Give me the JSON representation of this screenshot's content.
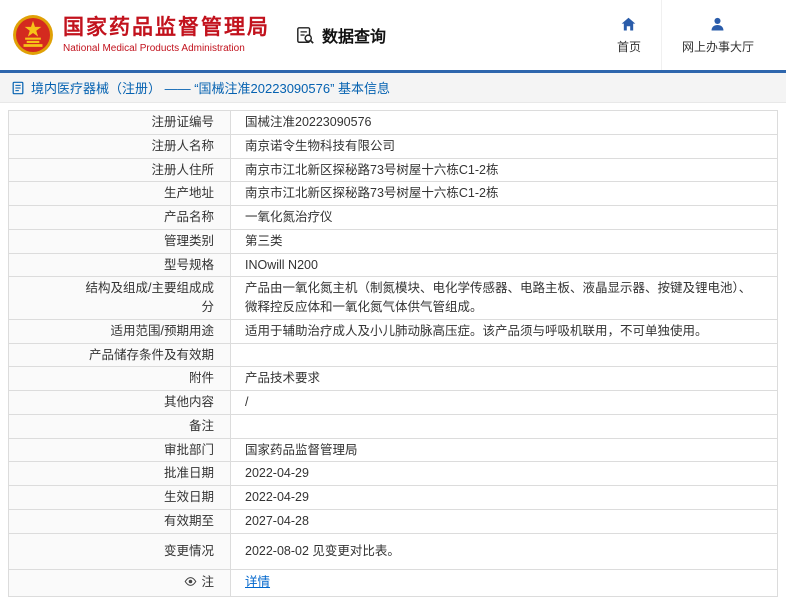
{
  "header": {
    "org_name_cn": "国家药品监督管理局",
    "org_name_en": "National Medical Products Administration",
    "data_query_label": "数据查询",
    "nav_home_label": "首页",
    "nav_hall_label": "网上办事大厅"
  },
  "breadcrumb": {
    "text": "境内医疗器械（注册） —— “国械注准20223090576” 基本信息"
  },
  "colors": {
    "brand_red": "#c2121d",
    "accent_blue": "#2e66ad",
    "link_blue": "#0066cc",
    "breadcrumb_blue": "#0562b1"
  },
  "icons": {
    "brand": "national-emblem-icon",
    "query": "document-search-icon",
    "home": "home-icon",
    "hall": "person-icon",
    "breadcrumb": "document-icon",
    "note_row": "eye-icon"
  },
  "detail_table": {
    "rows": [
      {
        "label": "注册证编号",
        "value": "国械注准20223090576"
      },
      {
        "label": "注册人名称",
        "value": "南京诺令生物科技有限公司"
      },
      {
        "label": "注册人住所",
        "value": "南京市江北新区探秘路73号树屋十六栋C1-2栋"
      },
      {
        "label": "生产地址",
        "value": "南京市江北新区探秘路73号树屋十六栋C1-2栋"
      },
      {
        "label": "产品名称",
        "value": "一氧化氮治疗仪"
      },
      {
        "label": "管理类别",
        "value": "第三类"
      },
      {
        "label": "型号规格",
        "value": "INOwill N200"
      },
      {
        "label": "结构及组成/主要组成成分",
        "value": "产品由一氧化氮主机（制氮模块、电化学传感器、电路主板、液晶显示器、按键及锂电池）、微释控反应体和一氧化氮气体供气管组成。"
      },
      {
        "label": "适用范围/预期用途",
        "value": "适用于辅助治疗成人及小儿肺动脉高压症。该产品须与呼吸机联用，不可单独使用。"
      },
      {
        "label": "产品储存条件及有效期",
        "value": ""
      },
      {
        "label": "附件",
        "value": "产品技术要求"
      },
      {
        "label": "其他内容",
        "value": "/"
      },
      {
        "label": "备注",
        "value": ""
      },
      {
        "label": "审批部门",
        "value": "国家药品监督管理局"
      },
      {
        "label": "批准日期",
        "value": "2022-04-29"
      },
      {
        "label": "生效日期",
        "value": "2022-04-29"
      },
      {
        "label": "有效期至",
        "value": "2027-04-28"
      },
      {
        "label": "变更情况",
        "value": "2022-08-02 见变更对比表。",
        "tall": true
      },
      {
        "label": "注",
        "value": "详情",
        "link": true,
        "icon": "eye",
        "last": true
      }
    ]
  }
}
